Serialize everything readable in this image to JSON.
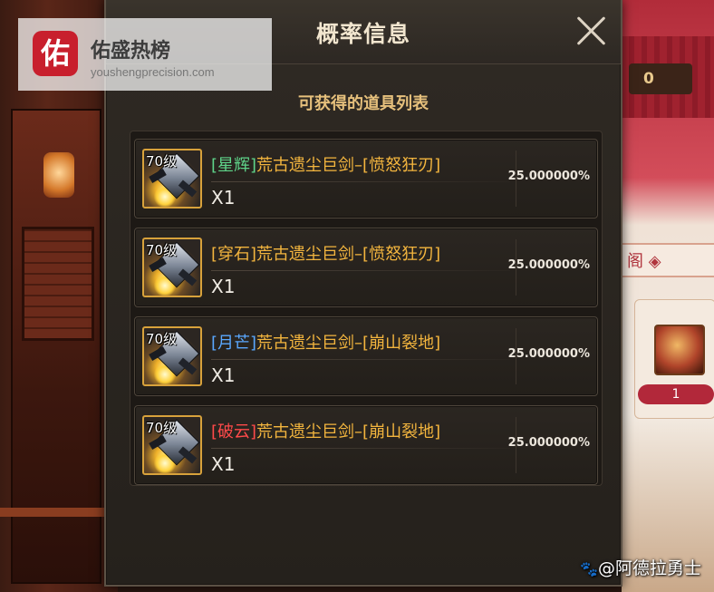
{
  "watermark": {
    "logo_char": "佑",
    "title": "佑盛热榜",
    "url": "youshengprecision.com"
  },
  "background": {
    "right_banner_value": "0",
    "right_tab_text": "阁 ◈",
    "right_count": "1"
  },
  "dialog": {
    "title": "概率信息",
    "close_icon": "close-icon",
    "subtitle": "可获得的道具列表",
    "items": [
      {
        "level": "70级",
        "tag": "[星辉]",
        "tag_color": "#5fd48a",
        "name": "荒古遗尘巨剑–[愤怒狂刃]",
        "qty": "X1",
        "rate": "25.000000%"
      },
      {
        "level": "70级",
        "tag": "[穿石]",
        "tag_color": "#f3b53e",
        "name": "荒古遗尘巨剑–[愤怒狂刃]",
        "qty": "X1",
        "rate": "25.000000%"
      },
      {
        "level": "70级",
        "tag": "[月芒]",
        "tag_color": "#5aa8ff",
        "name": "荒古遗尘巨剑–[崩山裂地]",
        "qty": "X1",
        "rate": "25.000000%"
      },
      {
        "level": "70级",
        "tag": "[破云]",
        "tag_color": "#ff4a4a",
        "name": "荒古遗尘巨剑–[崩山裂地]",
        "qty": "X1",
        "rate": "25.000000%"
      }
    ]
  },
  "footer": {
    "paw_icon": "paw-icon",
    "text": "@阿德拉勇士"
  }
}
